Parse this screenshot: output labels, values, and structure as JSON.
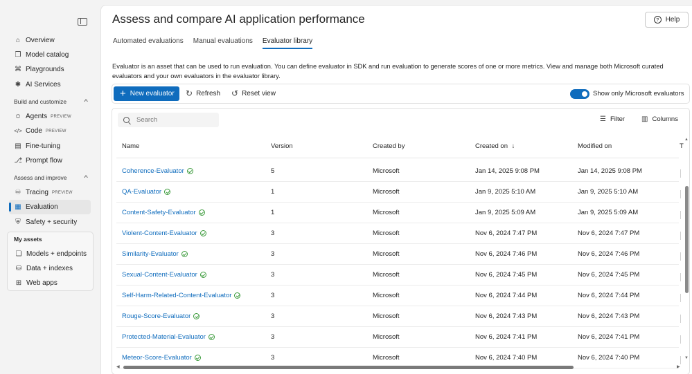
{
  "sidebar": {
    "items_top": [
      {
        "label": "Overview",
        "icon": "overview-icon",
        "glyph": "⌂"
      },
      {
        "label": "Model catalog",
        "icon": "model-catalog-icon",
        "glyph": "❒"
      },
      {
        "label": "Playgrounds",
        "icon": "playgrounds-icon",
        "glyph": "⌘"
      },
      {
        "label": "AI Services",
        "icon": "ai-services-icon",
        "glyph": "✱"
      }
    ],
    "section_build": "Build and customize",
    "items_build": [
      {
        "label": "Agents",
        "badge": "PREVIEW",
        "glyph": "☺"
      },
      {
        "label": "Code",
        "badge": "PREVIEW",
        "glyph": "</>"
      },
      {
        "label": "Fine-tuning",
        "glyph": "▤"
      },
      {
        "label": "Prompt flow",
        "glyph": "⎇"
      }
    ],
    "section_assess": "Assess and improve",
    "items_assess": [
      {
        "label": "Tracing",
        "badge": "PREVIEW",
        "glyph": "♾"
      },
      {
        "label": "Evaluation",
        "glyph": "▦"
      },
      {
        "label": "Safety + security",
        "glyph": "⛨"
      }
    ],
    "my_assets_title": "My assets",
    "items_assets": [
      {
        "label": "Models + endpoints",
        "glyph": "❏"
      },
      {
        "label": "Data + indexes",
        "glyph": "⛁"
      },
      {
        "label": "Web apps",
        "glyph": "⊞"
      }
    ]
  },
  "header": {
    "title": "Assess and compare AI application performance",
    "help_label": "Help"
  },
  "tabs": [
    "Automated evaluations",
    "Manual evaluations",
    "Evaluator library"
  ],
  "description": "Evaluator is an asset that can be used to run evaluation. You can define evaluator in SDK and run evaluation to generate scores of one or more metrics. View and manage both Microsoft curated evaluators and your own evaluators in the evaluator library.",
  "toolbar": {
    "new_label": "New evaluator",
    "refresh_label": "Refresh",
    "reset_label": "Reset view",
    "toggle_label": "Show only Microsoft evaluators"
  },
  "table": {
    "search_placeholder": "Search",
    "filter_label": "Filter",
    "columns_label": "Columns",
    "headers": {
      "name": "Name",
      "version": "Version",
      "created_by": "Created by",
      "created_on": "Created on",
      "created_on_sort": "↓",
      "modified_on": "Modified on",
      "extra": "T"
    },
    "rows": [
      {
        "name": "Coherence-Evaluator",
        "version": "5",
        "created_by": "Microsoft",
        "created_on": "Jan 14, 2025 9:08 PM",
        "modified_on": "Jan 14, 2025 9:08 PM"
      },
      {
        "name": "QA-Evaluator",
        "version": "1",
        "created_by": "Microsoft",
        "created_on": "Jan 9, 2025 5:10 AM",
        "modified_on": "Jan 9, 2025 5:10 AM"
      },
      {
        "name": "Content-Safety-Evaluator",
        "version": "1",
        "created_by": "Microsoft",
        "created_on": "Jan 9, 2025 5:09 AM",
        "modified_on": "Jan 9, 2025 5:09 AM"
      },
      {
        "name": "Violent-Content-Evaluator",
        "version": "3",
        "created_by": "Microsoft",
        "created_on": "Nov 6, 2024 7:47 PM",
        "modified_on": "Nov 6, 2024 7:47 PM"
      },
      {
        "name": "Similarity-Evaluator",
        "version": "3",
        "created_by": "Microsoft",
        "created_on": "Nov 6, 2024 7:46 PM",
        "modified_on": "Nov 6, 2024 7:46 PM"
      },
      {
        "name": "Sexual-Content-Evaluator",
        "version": "3",
        "created_by": "Microsoft",
        "created_on": "Nov 6, 2024 7:45 PM",
        "modified_on": "Nov 6, 2024 7:45 PM"
      },
      {
        "name": "Self-Harm-Related-Content-Evaluator",
        "version": "3",
        "created_by": "Microsoft",
        "created_on": "Nov 6, 2024 7:44 PM",
        "modified_on": "Nov 6, 2024 7:44 PM"
      },
      {
        "name": "Rouge-Score-Evaluator",
        "version": "3",
        "created_by": "Microsoft",
        "created_on": "Nov 6, 2024 7:43 PM",
        "modified_on": "Nov 6, 2024 7:43 PM"
      },
      {
        "name": "Protected-Material-Evaluator",
        "version": "3",
        "created_by": "Microsoft",
        "created_on": "Nov 6, 2024 7:41 PM",
        "modified_on": "Nov 6, 2024 7:41 PM"
      },
      {
        "name": "Meteor-Score-Evaluator",
        "version": "3",
        "created_by": "Microsoft",
        "created_on": "Nov 6, 2024 7:40 PM",
        "modified_on": "Nov 6, 2024 7:40 PM"
      }
    ]
  },
  "colors": {
    "accent": "#0f6cbd",
    "verified": "#3a9a3a"
  }
}
